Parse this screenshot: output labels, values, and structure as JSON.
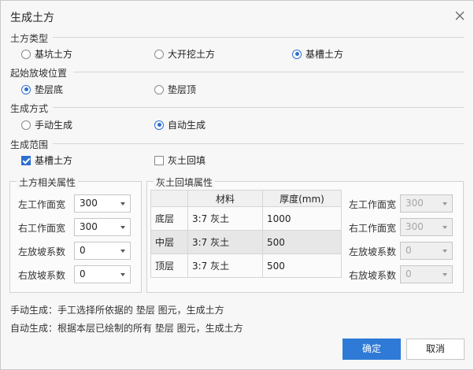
{
  "dialog": {
    "title": "生成土方"
  },
  "earthwork_type": {
    "label": "土方类型",
    "options": [
      {
        "label": "基坑土方",
        "selected": false
      },
      {
        "label": "大开挖土方",
        "selected": false
      },
      {
        "label": "基槽土方",
        "selected": true
      }
    ]
  },
  "start_slope": {
    "label": "起始放坡位置",
    "options": [
      {
        "label": "垫层底",
        "selected": true
      },
      {
        "label": "垫层顶",
        "selected": false
      }
    ]
  },
  "gen_method": {
    "label": "生成方式",
    "options": [
      {
        "label": "手动生成",
        "selected": false
      },
      {
        "label": "自动生成",
        "selected": true
      }
    ]
  },
  "gen_scope": {
    "label": "生成范围",
    "options": [
      {
        "label": "基槽土方",
        "checked": true
      },
      {
        "label": "灰土回填",
        "checked": false
      }
    ]
  },
  "earth_props": {
    "title": "土方相关属性",
    "fields": [
      {
        "label": "左工作面宽",
        "value": "300"
      },
      {
        "label": "右工作面宽",
        "value": "300"
      },
      {
        "label": "左放坡系数",
        "value": "0"
      },
      {
        "label": "右放坡系数",
        "value": "0"
      }
    ]
  },
  "fill_props": {
    "title": "灰土回填属性",
    "columns": [
      "",
      "材料",
      "厚度(mm)"
    ],
    "rows": [
      {
        "name": "底层",
        "material": "3:7 灰土",
        "thickness": "1000"
      },
      {
        "name": "中层",
        "material": "3:7 灰土",
        "thickness": "500"
      },
      {
        "name": "顶层",
        "material": "3:7 灰土",
        "thickness": "500"
      }
    ],
    "fields": [
      {
        "label": "左工作面宽",
        "value": "300"
      },
      {
        "label": "右工作面宽",
        "value": "300"
      },
      {
        "label": "左放坡系数",
        "value": "0"
      },
      {
        "label": "右放坡系数",
        "value": "0"
      }
    ]
  },
  "notes": [
    "手动生成：手工选择所依据的 垫层 图元，生成土方",
    "自动生成：根据本层已绘制的所有 垫层 图元，生成土方"
  ],
  "buttons": {
    "ok": "确定",
    "cancel": "取消"
  },
  "colors": {
    "accent": "#2e7ad6",
    "radio_on": "#2e6fd0"
  }
}
